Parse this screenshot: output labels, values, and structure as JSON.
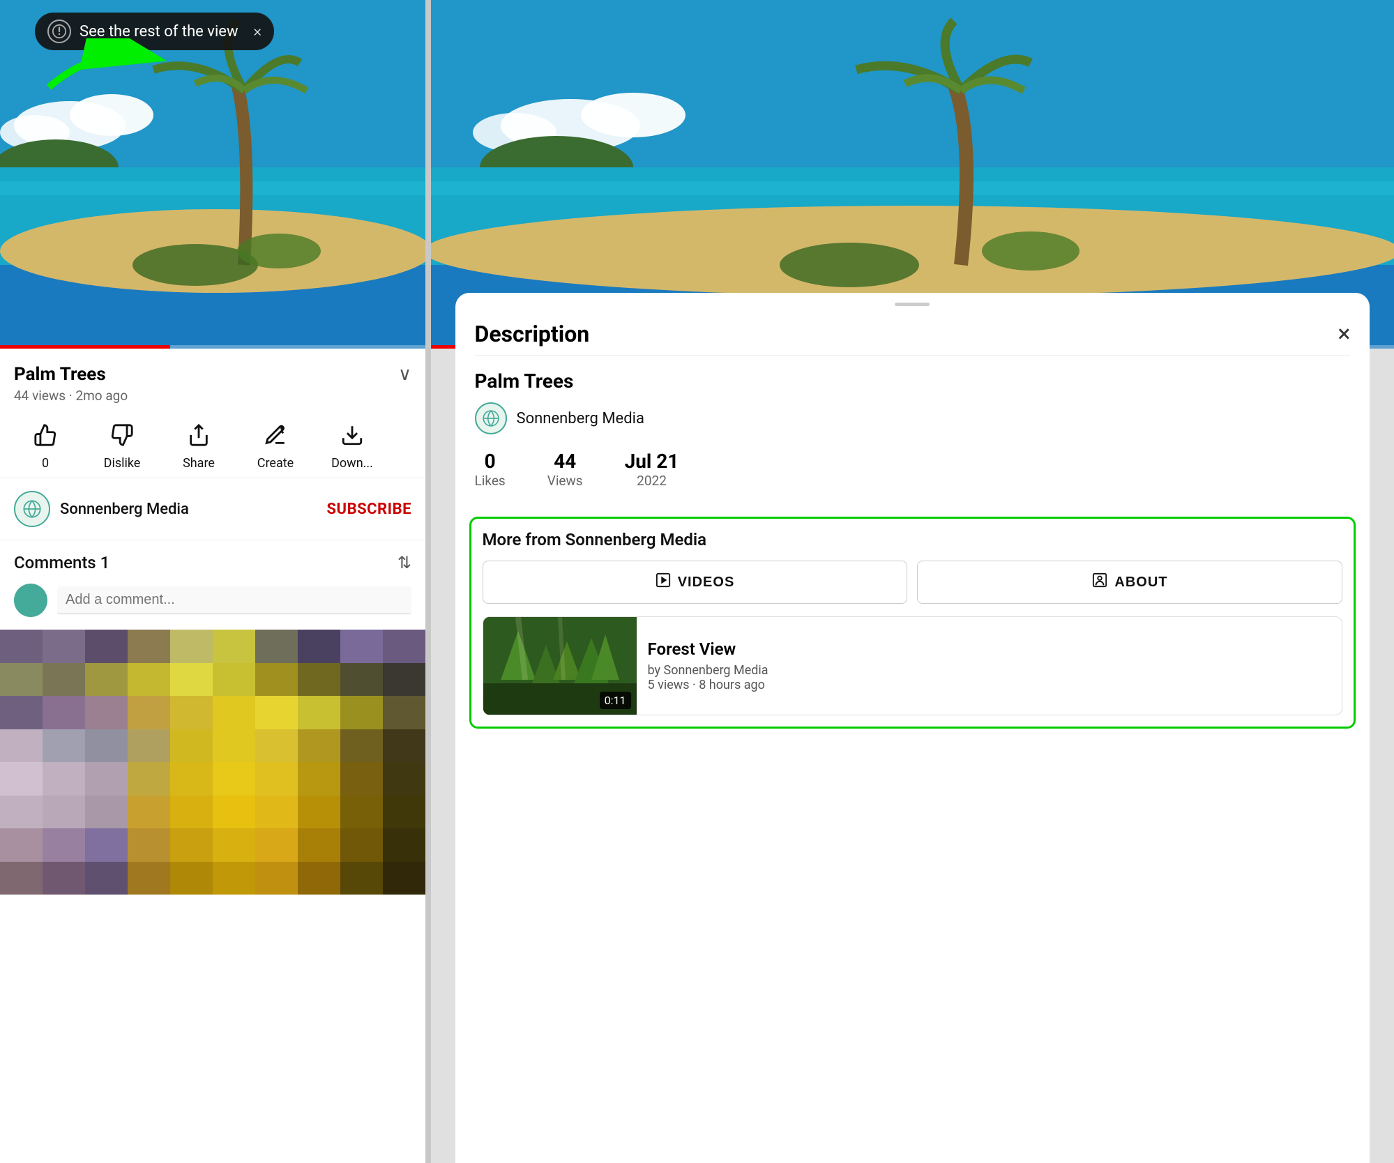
{
  "toast": {
    "text": "See the rest of the view",
    "close_label": "×"
  },
  "left": {
    "video_title": "Palm Trees",
    "video_meta": "44 views · 2mo ago",
    "actions": [
      {
        "id": "like",
        "icon": "👍",
        "label": "0"
      },
      {
        "id": "dislike",
        "icon": "👎",
        "label": "Dislike"
      },
      {
        "id": "share",
        "icon": "↗",
        "label": "Share"
      },
      {
        "id": "create",
        "icon": "✂",
        "label": "Create"
      },
      {
        "id": "download",
        "icon": "⬇",
        "label": "Down..."
      }
    ],
    "channel_name": "Sonnenberg Media",
    "subscribe_label": "SUBSCRIBE",
    "comments_title": "Comments",
    "comments_count": "1",
    "comment_placeholder": "Add a comment..."
  },
  "right": {
    "modal_title": "Description",
    "modal_close": "×",
    "video_title": "Palm Trees",
    "channel_name": "Sonnenberg Media",
    "stats": [
      {
        "value": "0",
        "label": "Likes"
      },
      {
        "value": "44",
        "label": "Views"
      },
      {
        "value": "Jul 21",
        "label": "2022"
      }
    ],
    "more_from_title": "More from Sonnenberg Media",
    "videos_btn": "VIDEOS",
    "about_btn": "ABOUT",
    "related_video": {
      "title": "Forest View",
      "channel": "by Sonnenberg Media",
      "meta": "5 views · 8 hours ago",
      "duration": "0:11"
    }
  },
  "colors": {
    "accent_green": "#00cc00",
    "subscribe_red": "#cc0000",
    "channel_teal": "#4a9",
    "progress_red": "#ee0000"
  },
  "color_cells": [
    "#6e5f7e",
    "#7b6d8a",
    "#5c4d6b",
    "#8c7a50",
    "#bfba65",
    "#c8c440",
    "#6e6e5a",
    "#4a4060",
    "#7a6a9a",
    "#6a5a80",
    "#8a8a60",
    "#7a7555",
    "#a09840",
    "#c4b830",
    "#e0d840",
    "#c8c030",
    "#a09020",
    "#706820",
    "#504e30",
    "#3a3830",
    "#706080",
    "#8a7090",
    "#9a8090",
    "#c0a040",
    "#d0b830",
    "#e0c820",
    "#e8d430",
    "#c8c030",
    "#9a9020",
    "#605830",
    "#c0b0c0",
    "#a0a0b0",
    "#9090a0",
    "#b0a060",
    "#d0b820",
    "#e0c820",
    "#d8c030",
    "#b09820",
    "#706020",
    "#403818",
    "#d0c0d0",
    "#c0b0c0",
    "#b0a0b0",
    "#c0a840",
    "#d8b818",
    "#e8c818",
    "#e0c020",
    "#b89810",
    "#786010",
    "#403810",
    "#c0b0c0",
    "#b8a8b8",
    "#a898a8",
    "#c8a030",
    "#d8b010",
    "#e8c010",
    "#e0b818",
    "#b89008",
    "#786008",
    "#403808",
    "#a890a0",
    "#9880a0",
    "#8070a0",
    "#b89030",
    "#c8a010",
    "#d8b010",
    "#d8a818",
    "#a88008",
    "#705808",
    "#383008",
    "#806870",
    "#705870",
    "#605070",
    "#a07820",
    "#b08808",
    "#c09808",
    "#c09010",
    "#906808",
    "#584808",
    "#302808"
  ]
}
